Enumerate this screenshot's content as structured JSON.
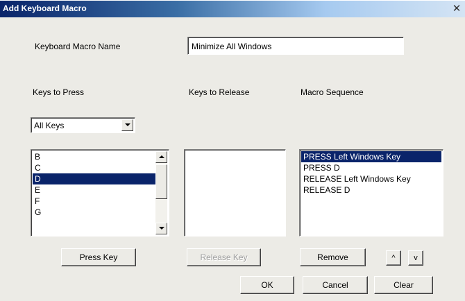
{
  "window": {
    "title": "Add Keyboard Macro",
    "close_glyph": "✕"
  },
  "macro_name": {
    "label": "Keyboard Macro Name",
    "value": "Minimize All Windows"
  },
  "columns": {
    "keys_to_press": "Keys to Press",
    "keys_to_release": "Keys to Release",
    "macro_sequence": "Macro Sequence"
  },
  "filter": {
    "selected": "All Keys"
  },
  "keys_list": {
    "items": [
      "B",
      "C",
      "D",
      "E",
      "F",
      "G"
    ],
    "selected_index": 2
  },
  "release_list": {
    "items": []
  },
  "sequence_list": {
    "items": [
      "PRESS Left Windows Key",
      "PRESS D",
      "RELEASE Left Windows Key",
      "RELEASE D"
    ],
    "selected_index": 0
  },
  "buttons": {
    "press_key": "Press Key",
    "release_key": "Release Key",
    "remove": "Remove",
    "move_up": "^",
    "move_down": "v",
    "ok": "OK",
    "cancel": "Cancel",
    "clear": "Clear"
  },
  "icons": {
    "close": "close-icon",
    "combo_arrow": "chevron-down-icon",
    "scroll_up": "scroll-up-icon",
    "scroll_down": "scroll-down-icon"
  },
  "colors": {
    "selection": "#0a246a",
    "title_bar_start": "#0a246a",
    "face": "#ecebe6"
  }
}
